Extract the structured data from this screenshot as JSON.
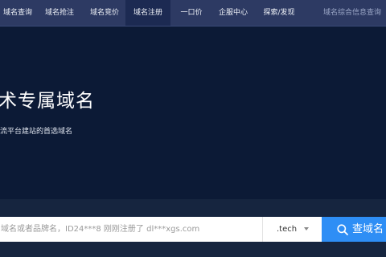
{
  "nav": {
    "items": [
      {
        "label": "域名查询",
        "active": false
      },
      {
        "label": "域名抢注",
        "active": false
      },
      {
        "label": "域名竞价",
        "active": false
      },
      {
        "label": "域名注册",
        "active": true
      },
      {
        "label": "一口价",
        "active": false
      },
      {
        "label": "企服中心",
        "active": false
      },
      {
        "label": "探索/发现",
        "active": false
      }
    ],
    "right_label": "域名综合信息查询"
  },
  "hero": {
    "title": "术专属域名",
    "subtitle": "流平台建站的首选域名"
  },
  "search": {
    "placeholder": "域名或者品牌名，ID24***8 刚刚注册了 dl***xgs.com",
    "tld_selected": ".tech",
    "button_label": "查域名"
  },
  "colors": {
    "nav_bg": "#2d3a63",
    "nav_active_bg": "#1c2a52",
    "hero_bg": "#0c1a36",
    "search_band_bg": "#16253f",
    "button_bg": "#2e8ef5"
  }
}
